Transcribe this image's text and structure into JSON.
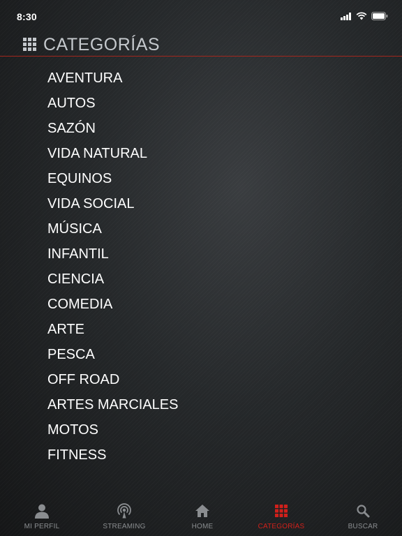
{
  "status_bar": {
    "time": "8:30",
    "icons": [
      "signal-icon",
      "wifi-icon",
      "battery-icon"
    ]
  },
  "header": {
    "icon": "grid-icon",
    "title": "CATEGORÍAS"
  },
  "categories": [
    "AVENTURA",
    "AUTOS",
    "SAZÓN",
    "VIDA NATURAL",
    "EQUINOS",
    "VIDA SOCIAL",
    "MÚSICA",
    "INFANTIL",
    "CIENCIA",
    "COMEDIA",
    "ARTE",
    "PESCA",
    "OFF ROAD",
    "ARTES MARCIALES",
    "MOTOS",
    "FITNESS"
  ],
  "tab_bar": {
    "tabs": [
      {
        "label": "MI PERFIL",
        "icon": "person-icon",
        "active": false
      },
      {
        "label": "STREAMING",
        "icon": "broadcast-icon",
        "active": false
      },
      {
        "label": "HOME",
        "icon": "home-icon",
        "active": false
      },
      {
        "label": "CATEGORÍAS",
        "icon": "grid-icon",
        "active": true
      },
      {
        "label": "BUSCAR",
        "icon": "search-icon",
        "active": false
      }
    ]
  },
  "colors": {
    "accent": "#d0201b",
    "header_rule": "#a3271d",
    "inactive": "#8a8d90",
    "title": "#c4c8cc"
  }
}
